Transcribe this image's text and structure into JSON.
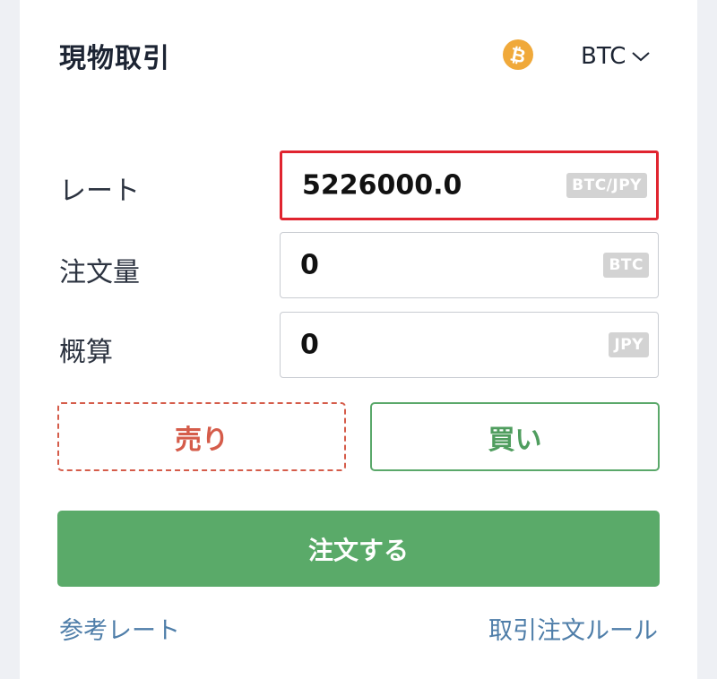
{
  "header": {
    "title": "現物取引",
    "currency": "BTC",
    "coin_icon": "bitcoin-icon",
    "coin_color": "#f0a93a"
  },
  "form": {
    "rate": {
      "label": "レート",
      "value": "5226000.0",
      "unit": "BTC/JPY"
    },
    "amount": {
      "label": "注文量",
      "value": "0",
      "unit": "BTC"
    },
    "estimate": {
      "label": "概算",
      "value": "0",
      "unit": "JPY"
    }
  },
  "actions": {
    "sell_label": "売り",
    "buy_label": "買い",
    "order_label": "注文する"
  },
  "links": {
    "reference_rate": "参考レート",
    "trading_rules": "取引注文ルール"
  },
  "colors": {
    "highlight": "#e0242f",
    "sell": "#d55c4a",
    "buy": "#5aa86a",
    "order_bg": "#5aaa69",
    "link": "#4f7ea9"
  }
}
